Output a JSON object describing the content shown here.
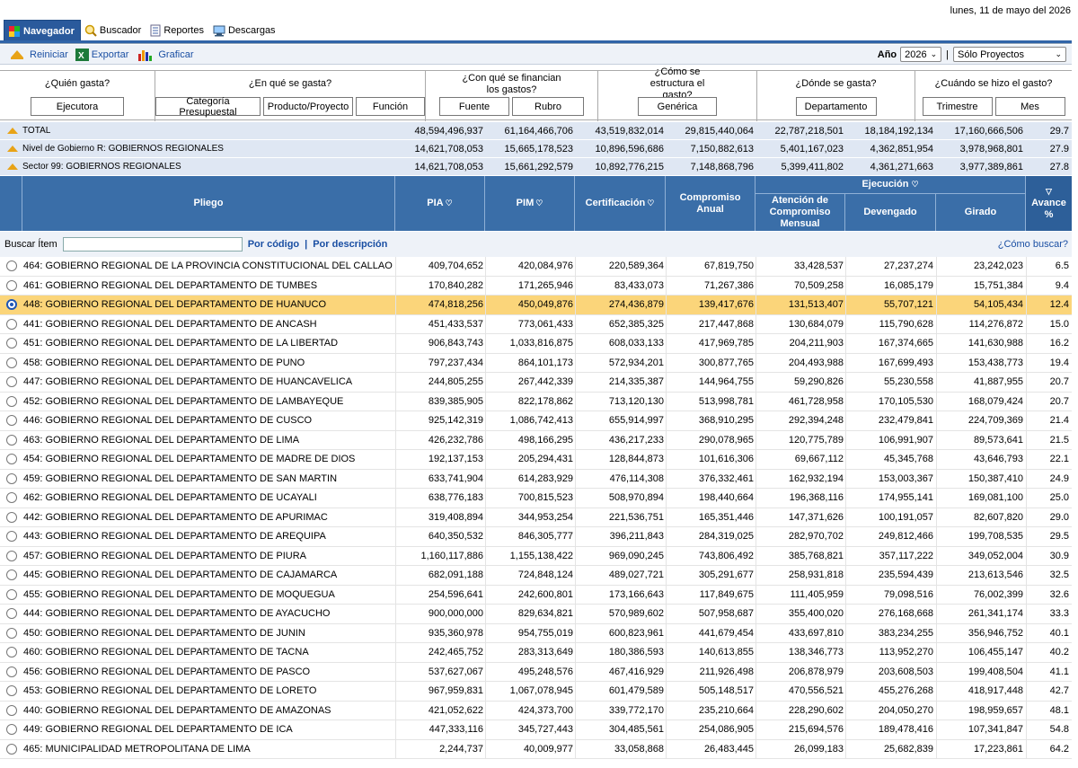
{
  "date": "lunes, 11 de mayo del 2026",
  "tabs": [
    {
      "label": "Navegador",
      "icon": "navigator-icon"
    },
    {
      "label": "Buscador",
      "icon": "search-icon"
    },
    {
      "label": "Reportes",
      "icon": "report-icon"
    },
    {
      "label": "Descargas",
      "icon": "download-icon"
    }
  ],
  "toolbar": {
    "reset": "Reiniciar",
    "export": "Exportar",
    "chart": "Graficar"
  },
  "filters": {
    "year_label": "Año",
    "year": "2026",
    "mode": "Sólo Proyectos"
  },
  "questions": [
    {
      "title": "¿Quién gasta?",
      "buttons": [
        "Ejecutora"
      ]
    },
    {
      "title": "¿En qué se gasta?",
      "buttons": [
        "Categoría Presupuestal",
        "Producto/Proyecto",
        "Función"
      ]
    },
    {
      "title": "¿Con qué se financian los gastos?",
      "buttons": [
        "Fuente",
        "Rubro"
      ]
    },
    {
      "title": "¿Cómo se estructura el gasto?",
      "buttons": [
        "Genérica"
      ]
    },
    {
      "title": "¿Dónde se gasta?",
      "buttons": [
        "Departamento"
      ]
    },
    {
      "title": "¿Cuándo se hizo el gasto?",
      "buttons": [
        "Trimestre",
        "Mes"
      ]
    }
  ],
  "summary": [
    {
      "label": "TOTAL",
      "values": [
        "48,594,496,937",
        "61,164,466,706",
        "43,519,832,014",
        "29,815,440,064",
        "22,787,218,501",
        "18,184,192,134",
        "17,160,666,506",
        "29.7"
      ]
    },
    {
      "label": "Nivel de Gobierno R: GOBIERNOS REGIONALES",
      "values": [
        "14,621,708,053",
        "15,665,178,523",
        "10,896,596,686",
        "7,150,882,613",
        "5,401,167,023",
        "4,362,851,954",
        "3,978,968,801",
        "27.9"
      ]
    },
    {
      "label": "Sector 99: GOBIERNOS REGIONALES",
      "values": [
        "14,621,708,053",
        "15,661,292,579",
        "10,892,776,215",
        "7,148,868,796",
        "5,399,411,802",
        "4,361,271,663",
        "3,977,389,861",
        "27.8"
      ]
    }
  ],
  "headers": {
    "pliego": "Pliego",
    "pia": "PIA",
    "pim": "PIM",
    "cert": "Certificación",
    "comp_anual": "Compromiso Anual",
    "ejecucion": "Ejecución",
    "atencion": "Atención de Compromiso Mensual",
    "devengado": "Devengado",
    "girado": "Girado",
    "avance": "Avance %"
  },
  "search": {
    "label": "Buscar Ítem",
    "by_code": "Por código",
    "sep": "|",
    "by_desc": "Por descripción",
    "help": "¿Cómo buscar?"
  },
  "rows": [
    {
      "name": "464: GOBIERNO REGIONAL DE LA PROVINCIA CONSTITUCIONAL DEL CALLAO",
      "v": [
        "409,704,652",
        "420,084,976",
        "220,589,364",
        "67,819,750",
        "33,428,537",
        "27,237,274",
        "23,242,023",
        "6.5"
      ]
    },
    {
      "name": "461: GOBIERNO REGIONAL DEL DEPARTAMENTO DE TUMBES",
      "v": [
        "170,840,282",
        "171,265,946",
        "83,433,073",
        "71,267,386",
        "70,509,258",
        "16,085,179",
        "15,751,384",
        "9.4"
      ]
    },
    {
      "name": "448: GOBIERNO REGIONAL DEL DEPARTAMENTO DE HUANUCO",
      "v": [
        "474,818,256",
        "450,049,876",
        "274,436,879",
        "139,417,676",
        "131,513,407",
        "55,707,121",
        "54,105,434",
        "12.4"
      ],
      "selected": true
    },
    {
      "name": "441: GOBIERNO REGIONAL DEL DEPARTAMENTO DE ANCASH",
      "v": [
        "451,433,537",
        "773,061,433",
        "652,385,325",
        "217,447,868",
        "130,684,079",
        "115,790,628",
        "114,276,872",
        "15.0"
      ]
    },
    {
      "name": "451: GOBIERNO REGIONAL DEL DEPARTAMENTO DE LA LIBERTAD",
      "v": [
        "906,843,743",
        "1,033,816,875",
        "608,033,133",
        "417,969,785",
        "204,211,903",
        "167,374,665",
        "141,630,988",
        "16.2"
      ]
    },
    {
      "name": "458: GOBIERNO REGIONAL DEL DEPARTAMENTO DE PUNO",
      "v": [
        "797,237,434",
        "864,101,173",
        "572,934,201",
        "300,877,765",
        "204,493,988",
        "167,699,493",
        "153,438,773",
        "19.4"
      ]
    },
    {
      "name": "447: GOBIERNO REGIONAL DEL DEPARTAMENTO DE HUANCAVELICA",
      "v": [
        "244,805,255",
        "267,442,339",
        "214,335,387",
        "144,964,755",
        "59,290,826",
        "55,230,558",
        "41,887,955",
        "20.7"
      ]
    },
    {
      "name": "452: GOBIERNO REGIONAL DEL DEPARTAMENTO DE LAMBAYEQUE",
      "v": [
        "839,385,905",
        "822,178,862",
        "713,120,130",
        "513,998,781",
        "461,728,958",
        "170,105,530",
        "168,079,424",
        "20.7"
      ]
    },
    {
      "name": "446: GOBIERNO REGIONAL DEL DEPARTAMENTO DE CUSCO",
      "v": [
        "925,142,319",
        "1,086,742,413",
        "655,914,997",
        "368,910,295",
        "292,394,248",
        "232,479,841",
        "224,709,369",
        "21.4"
      ]
    },
    {
      "name": "463: GOBIERNO REGIONAL DEL DEPARTAMENTO DE LIMA",
      "v": [
        "426,232,786",
        "498,166,295",
        "436,217,233",
        "290,078,965",
        "120,775,789",
        "106,991,907",
        "89,573,641",
        "21.5"
      ]
    },
    {
      "name": "454: GOBIERNO REGIONAL DEL DEPARTAMENTO DE MADRE DE DIOS",
      "v": [
        "192,137,153",
        "205,294,431",
        "128,844,873",
        "101,616,306",
        "69,667,112",
        "45,345,768",
        "43,646,793",
        "22.1"
      ]
    },
    {
      "name": "459: GOBIERNO REGIONAL DEL DEPARTAMENTO DE SAN MARTIN",
      "v": [
        "633,741,904",
        "614,283,929",
        "476,114,308",
        "376,332,461",
        "162,932,194",
        "153,003,367",
        "150,387,410",
        "24.9"
      ]
    },
    {
      "name": "462: GOBIERNO REGIONAL DEL DEPARTAMENTO DE UCAYALI",
      "v": [
        "638,776,183",
        "700,815,523",
        "508,970,894",
        "198,440,664",
        "196,368,116",
        "174,955,141",
        "169,081,100",
        "25.0"
      ]
    },
    {
      "name": "442: GOBIERNO REGIONAL DEL DEPARTAMENTO DE APURIMAC",
      "v": [
        "319,408,894",
        "344,953,254",
        "221,536,751",
        "165,351,446",
        "147,371,626",
        "100,191,057",
        "82,607,820",
        "29.0"
      ]
    },
    {
      "name": "443: GOBIERNO REGIONAL DEL DEPARTAMENTO DE AREQUIPA",
      "v": [
        "640,350,532",
        "846,305,777",
        "396,211,843",
        "284,319,025",
        "282,970,702",
        "249,812,466",
        "199,708,535",
        "29.5"
      ]
    },
    {
      "name": "457: GOBIERNO REGIONAL DEL DEPARTAMENTO DE PIURA",
      "v": [
        "1,160,117,886",
        "1,155,138,422",
        "969,090,245",
        "743,806,492",
        "385,768,821",
        "357,117,222",
        "349,052,004",
        "30.9"
      ]
    },
    {
      "name": "445: GOBIERNO REGIONAL DEL DEPARTAMENTO DE CAJAMARCA",
      "v": [
        "682,091,188",
        "724,848,124",
        "489,027,721",
        "305,291,677",
        "258,931,818",
        "235,594,439",
        "213,613,546",
        "32.5"
      ]
    },
    {
      "name": "455: GOBIERNO REGIONAL DEL DEPARTAMENTO DE MOQUEGUA",
      "v": [
        "254,596,641",
        "242,600,801",
        "173,166,643",
        "117,849,675",
        "111,405,959",
        "79,098,516",
        "76,002,399",
        "32.6"
      ]
    },
    {
      "name": "444: GOBIERNO REGIONAL DEL DEPARTAMENTO DE AYACUCHO",
      "v": [
        "900,000,000",
        "829,634,821",
        "570,989,602",
        "507,958,687",
        "355,400,020",
        "276,168,668",
        "261,341,174",
        "33.3"
      ]
    },
    {
      "name": "450: GOBIERNO REGIONAL DEL DEPARTAMENTO DE JUNIN",
      "v": [
        "935,360,978",
        "954,755,019",
        "600,823,961",
        "441,679,454",
        "433,697,810",
        "383,234,255",
        "356,946,752",
        "40.1"
      ]
    },
    {
      "name": "460: GOBIERNO REGIONAL DEL DEPARTAMENTO DE TACNA",
      "v": [
        "242,465,752",
        "283,313,649",
        "180,386,593",
        "140,613,855",
        "138,346,773",
        "113,952,270",
        "106,455,147",
        "40.2"
      ]
    },
    {
      "name": "456: GOBIERNO REGIONAL DEL DEPARTAMENTO DE PASCO",
      "v": [
        "537,627,067",
        "495,248,576",
        "467,416,929",
        "211,926,498",
        "206,878,979",
        "203,608,503",
        "199,408,504",
        "41.1"
      ]
    },
    {
      "name": "453: GOBIERNO REGIONAL DEL DEPARTAMENTO DE LORETO",
      "v": [
        "967,959,831",
        "1,067,078,945",
        "601,479,589",
        "505,148,517",
        "470,556,521",
        "455,276,268",
        "418,917,448",
        "42.7"
      ]
    },
    {
      "name": "440: GOBIERNO REGIONAL DEL DEPARTAMENTO DE AMAZONAS",
      "v": [
        "421,052,622",
        "424,373,700",
        "339,772,170",
        "235,210,664",
        "228,290,602",
        "204,050,270",
        "198,959,657",
        "48.1"
      ]
    },
    {
      "name": "449: GOBIERNO REGIONAL DEL DEPARTAMENTO DE ICA",
      "v": [
        "447,333,116",
        "345,727,443",
        "304,485,561",
        "254,086,905",
        "215,694,576",
        "189,478,416",
        "107,341,847",
        "54.8"
      ]
    },
    {
      "name": "465: MUNICIPALIDAD METROPOLITANA DE LIMA",
      "v": [
        "2,244,737",
        "40,009,977",
        "33,058,868",
        "26,483,445",
        "26,099,183",
        "25,682,839",
        "17,223,861",
        "64.2"
      ]
    }
  ]
}
